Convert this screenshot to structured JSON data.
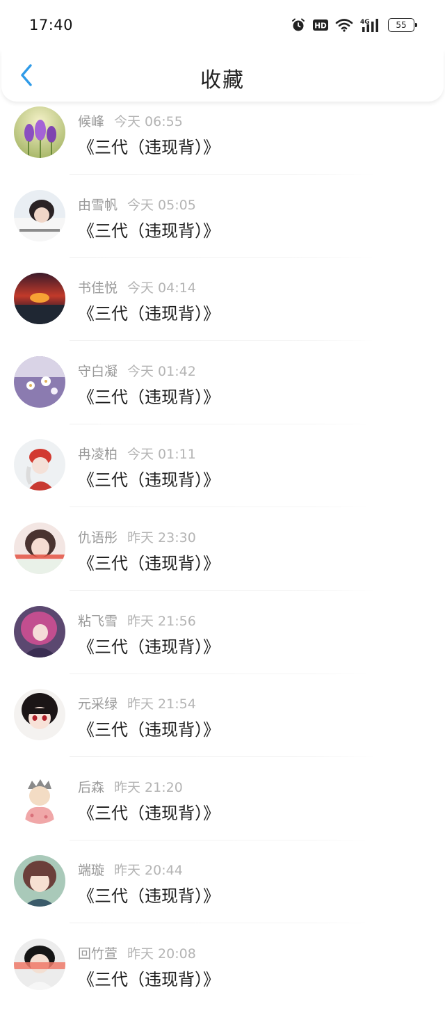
{
  "status_bar": {
    "time": "17:40",
    "hd_label": "HD",
    "network_label": "4G",
    "battery_level": "55",
    "icons": [
      "alarm-icon",
      "hd-icon",
      "wifi-icon",
      "signal-4g-icon",
      "battery-icon"
    ]
  },
  "header": {
    "title": "收藏",
    "back_icon": "chevron-left-icon"
  },
  "colors": {
    "accent": "#2f9be8",
    "meta_text": "#9a9a9a",
    "title_text": "#1c1c1c"
  },
  "items": [
    {
      "user": "候峰",
      "time": "今天 06:55",
      "title": "《三代（违现背）》"
    },
    {
      "user": "由雪帆",
      "time": "今天 05:05",
      "title": "《三代（违现背）》"
    },
    {
      "user": "书佳悦",
      "time": "今天 04:14",
      "title": "《三代（违现背）》"
    },
    {
      "user": "守白凝",
      "time": "今天 01:42",
      "title": "《三代（违现背）》"
    },
    {
      "user": "冉凌柏",
      "time": "今天 01:11",
      "title": "《三代（违现背）》"
    },
    {
      "user": "仇语彤",
      "time": "昨天 23:30",
      "title": "《三代（违现背）》"
    },
    {
      "user": "粘飞雪",
      "time": "昨天 21:56",
      "title": "《三代（违现背）》"
    },
    {
      "user": "元采绿",
      "time": "昨天 21:54",
      "title": "《三代（违现背）》"
    },
    {
      "user": "后森",
      "time": "昨天 21:20",
      "title": "《三代（违现背）》"
    },
    {
      "user": "端璇",
      "time": "昨天 20:44",
      "title": "《三代（违现背）》"
    },
    {
      "user": "回竹萱",
      "time": "昨天 20:08",
      "title": "《三代（违现背）》"
    }
  ]
}
